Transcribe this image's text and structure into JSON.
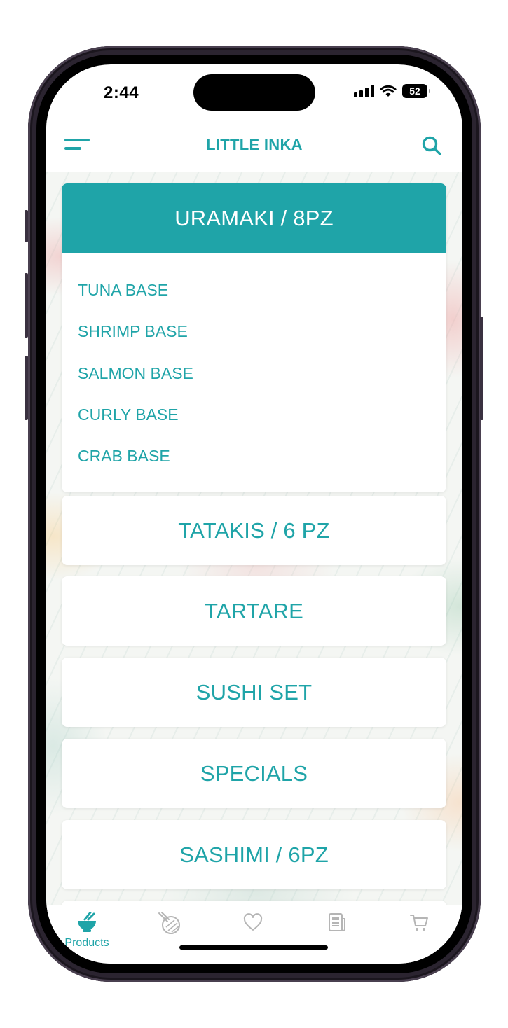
{
  "status_bar": {
    "time": "2:44",
    "battery": "52",
    "icons": [
      "cellular-signal-icon",
      "wifi-icon",
      "battery-icon"
    ]
  },
  "header": {
    "title": "LITTLE INKA",
    "left_icon": "menu-icon",
    "right_icon": "search-icon"
  },
  "categories": [
    {
      "label": "URAMAKI / 8PZ",
      "expanded": true,
      "items": [
        "TUNA BASE",
        "SHRIMP BASE",
        "SALMON BASE",
        "CURLY BASE",
        "CRAB BASE"
      ]
    },
    {
      "label": "TATAKIS / 6 PZ",
      "expanded": false
    },
    {
      "label": "TARTARE",
      "expanded": false
    },
    {
      "label": "SUSHI SET",
      "expanded": false
    },
    {
      "label": "SPECIALS",
      "expanded": false
    },
    {
      "label": "SASHIMI / 6PZ",
      "expanded": false
    }
  ],
  "tabbar": {
    "items": [
      {
        "label": "Products",
        "icon": "bowl-icon",
        "active": true
      },
      {
        "icon": "poke-bowl-icon",
        "active": false
      },
      {
        "icon": "heart-icon",
        "active": false
      },
      {
        "icon": "news-icon",
        "active": false
      },
      {
        "icon": "cart-icon",
        "active": false
      }
    ]
  },
  "colors": {
    "accent": "#1fa4a8",
    "inactive_icon": "#b5b5b5",
    "card_bg": "#ffffff"
  }
}
